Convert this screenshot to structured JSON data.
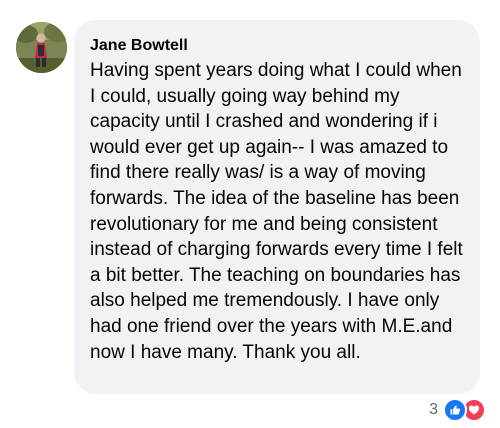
{
  "comment": {
    "author": "Jane Bowtell",
    "text": "Having spent years doing what I could when I could, usually going way behind my capacity until I crashed and wondering if i would ever get up again-- I was amazed to find there really was/ is a way of moving forwards. The idea of the baseline has been revolutionary for me and being consistent instead of charging forwards every time I felt a bit better. The teaching on boundaries has also helped me tremendously. I have only had one friend over the years with M.E.and now I have many. Thank you all."
  },
  "reactions": {
    "count": "3",
    "icons": [
      "like-icon",
      "love-icon"
    ]
  },
  "colors": {
    "bubble_bg": "#f0f2f5",
    "text": "#050505",
    "muted": "#65676b",
    "like_blue": "#1877f2",
    "love_red": "#f33e58"
  }
}
